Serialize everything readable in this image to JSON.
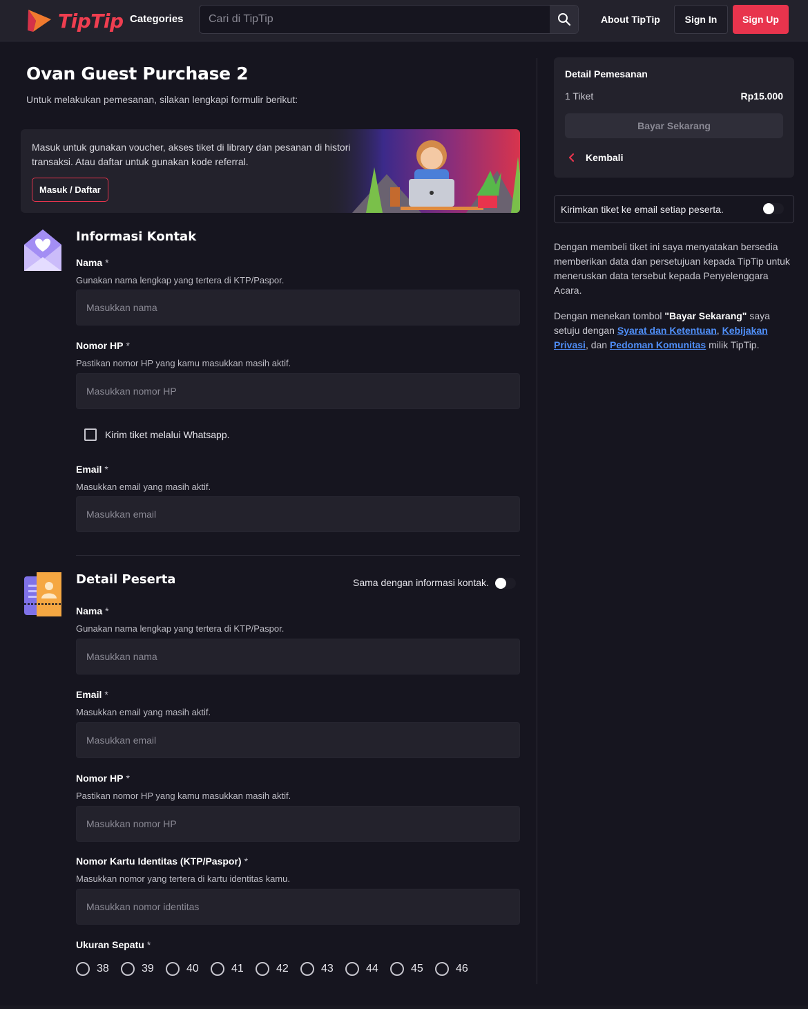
{
  "header": {
    "brand": "TipTip",
    "categories_label": "Categories",
    "search_placeholder": "Cari di TipTip",
    "about_label": "About TipTip",
    "signin_label": "Sign In",
    "signup_label": "Sign Up",
    "accent_color": "#e8344d"
  },
  "page": {
    "title": "Ovan Guest Purchase 2",
    "subtitle": "Untuk melakukan pemesanan, silakan lengkapi formulir berikut:"
  },
  "banner": {
    "text": "Masuk untuk gunakan voucher, akses tiket di library dan pesanan di histori transaksi. Atau daftar untuk gunakan kode referral.",
    "button_label": "Masuk / Daftar"
  },
  "contact": {
    "title": "Informasi Kontak",
    "name": {
      "label": "Nama",
      "required": "*",
      "help": "Gunakan nama lengkap yang tertera di KTP/Paspor.",
      "placeholder": "Masukkan nama",
      "value": ""
    },
    "phone": {
      "label": "Nomor HP",
      "required": "*",
      "help": "Pastikan nomor HP yang kamu masukkan masih aktif.",
      "placeholder": "Masukkan nomor HP",
      "value": ""
    },
    "whatsapp_checkbox": {
      "label": "Kirim tiket melalui Whatsapp.",
      "checked": false
    },
    "email": {
      "label": "Email",
      "required": "*",
      "help": "Masukkan email yang masih aktif.",
      "placeholder": "Masukkan email",
      "value": ""
    }
  },
  "participant": {
    "title": "Detail Peserta",
    "same_as_contact": {
      "label": "Sama dengan informasi kontak.",
      "on": false
    },
    "name": {
      "label": "Nama",
      "required": "*",
      "help": "Gunakan nama lengkap yang tertera di KTP/Paspor.",
      "placeholder": "Masukkan nama",
      "value": ""
    },
    "email": {
      "label": "Email",
      "required": "*",
      "help": "Masukkan email yang masih aktif.",
      "placeholder": "Masukkan email",
      "value": ""
    },
    "phone": {
      "label": "Nomor HP",
      "required": "*",
      "help": "Pastikan nomor HP yang kamu masukkan masih aktif.",
      "placeholder": "Masukkan nomor HP",
      "value": ""
    },
    "id_number": {
      "label": "Nomor Kartu Identitas (KTP/Paspor)",
      "required": "*",
      "help": "Masukkan nomor yang tertera di kartu identitas kamu.",
      "placeholder": "Masukkan nomor identitas",
      "value": ""
    },
    "shoe_size": {
      "label": "Ukuran Sepatu",
      "required": "*",
      "options": [
        "38",
        "39",
        "40",
        "41",
        "42",
        "43",
        "44",
        "45",
        "46"
      ],
      "selected": null
    }
  },
  "order": {
    "title": "Detail Pemesanan",
    "quantity": "1 Tiket",
    "price": "Rp15.000",
    "pay_label": "Bayar Sekarang",
    "back_label": "Kembali"
  },
  "email_each": {
    "label": "Kirimkan tiket ke email setiap peserta.",
    "on": false
  },
  "disclaimer": {
    "p1": "Dengan membeli tiket ini saya menyatakan bersedia memberikan data dan persetujuan kepada TipTip untuk meneruskan data tersebut kepada Penyelenggara Acara.",
    "p2_prefix": "Dengan menekan tombol ",
    "p2_bold": "\"Bayar Sekarang\"",
    "p2_mid": " saya setuju dengan ",
    "link_terms": "Syarat dan Ketentuan",
    "comma": ", ",
    "link_privacy": "Kebijakan Privasi",
    "and": ", dan ",
    "link_guidelines": "Pedoman Komunitas",
    "suffix": " milik TipTip.",
    "link_color": "#4f8ef7"
  }
}
